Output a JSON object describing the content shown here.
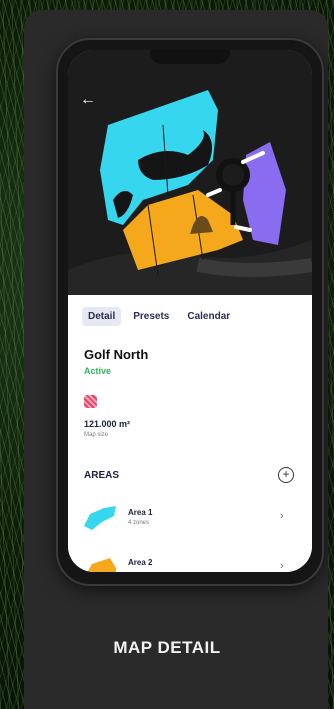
{
  "header": {
    "back_label": "←"
  },
  "tabs": [
    {
      "label": "Detail",
      "active": true
    },
    {
      "label": "Presets",
      "active": false
    },
    {
      "label": "Calendar",
      "active": false
    }
  ],
  "map_info": {
    "name": "Golf North",
    "status": "Active",
    "size_value": "121.000 m²",
    "size_label": "Map size"
  },
  "areas": {
    "title": "AREAS",
    "add_icon": "plus-circle-icon",
    "items": [
      {
        "name": "Area 1",
        "subtitle": "4 zones",
        "color": "#35d6ee"
      },
      {
        "name": "Area 2",
        "subtitle": "",
        "color": "#f5a81c"
      }
    ]
  },
  "caption": "MAP DETAIL",
  "colors": {
    "cyan": "#35d6ee",
    "orange": "#f5a81c",
    "purple": "#8a6cf0",
    "active": "#2fb45a"
  }
}
